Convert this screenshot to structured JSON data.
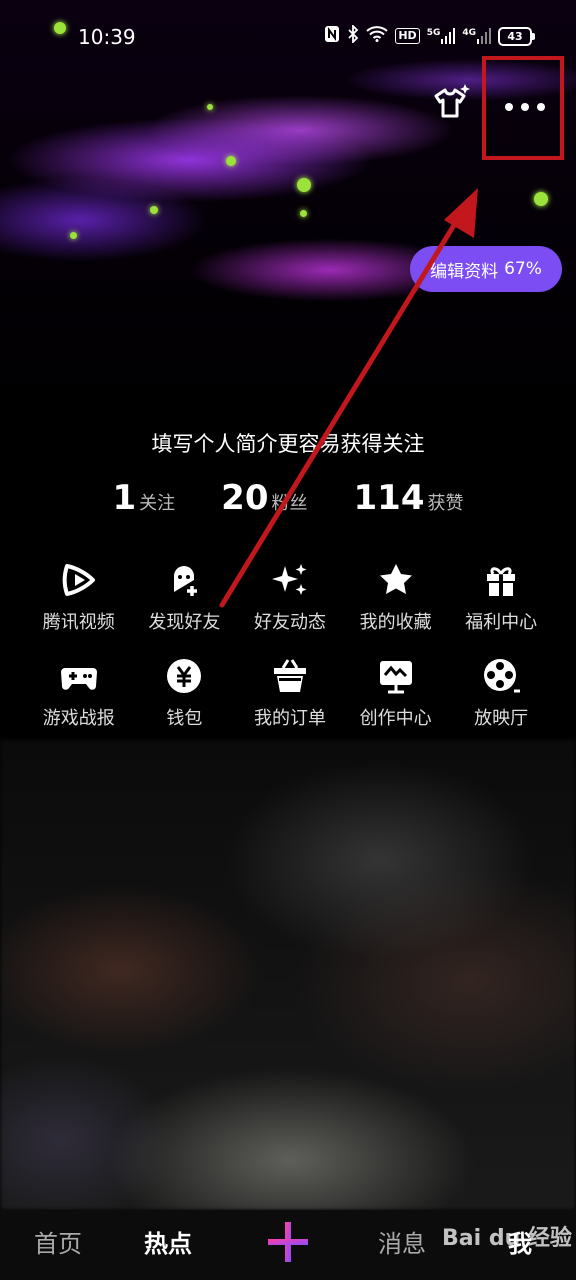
{
  "status_bar": {
    "time": "10:39",
    "icons": [
      "nfc-icon",
      "bluetooth-icon",
      "wifi-icon",
      "hd-icon",
      "5g-signal-icon",
      "4g-signal-icon"
    ],
    "hd": "HD",
    "net5g": "5G",
    "net4g": "4G",
    "battery": "43"
  },
  "profile": {
    "edit_label": "编辑资料",
    "edit_percent": "67%",
    "bio_hint": "填写个人简介更容易获得关注"
  },
  "stats": [
    {
      "value": "1",
      "label": "关注"
    },
    {
      "value": "20",
      "label": "粉丝"
    },
    {
      "value": "114",
      "label": "获赞"
    }
  ],
  "grid_row1": [
    {
      "label": "腾讯视频",
      "icon": "tencent-video-icon"
    },
    {
      "label": "发现好友",
      "icon": "discover-friends-icon"
    },
    {
      "label": "好友动态",
      "icon": "sparkle-icon"
    },
    {
      "label": "我的收藏",
      "icon": "star-icon"
    },
    {
      "label": "福利中心",
      "icon": "gift-icon"
    }
  ],
  "grid_row2": [
    {
      "label": "游戏战报",
      "icon": "gamepad-icon"
    },
    {
      "label": "钱包",
      "icon": "wallet-icon"
    },
    {
      "label": "我的订单",
      "icon": "basket-icon"
    },
    {
      "label": "创作中心",
      "icon": "creator-icon"
    },
    {
      "label": "放映厅",
      "icon": "film-reel-icon"
    }
  ],
  "bottom_nav": {
    "home": "首页",
    "hot": "热点",
    "messages": "消息",
    "me": "我"
  },
  "watermark": "Bai du 经验",
  "colors": {
    "accent_purple": "#7b4df2",
    "highlight_red": "#c2171c"
  }
}
